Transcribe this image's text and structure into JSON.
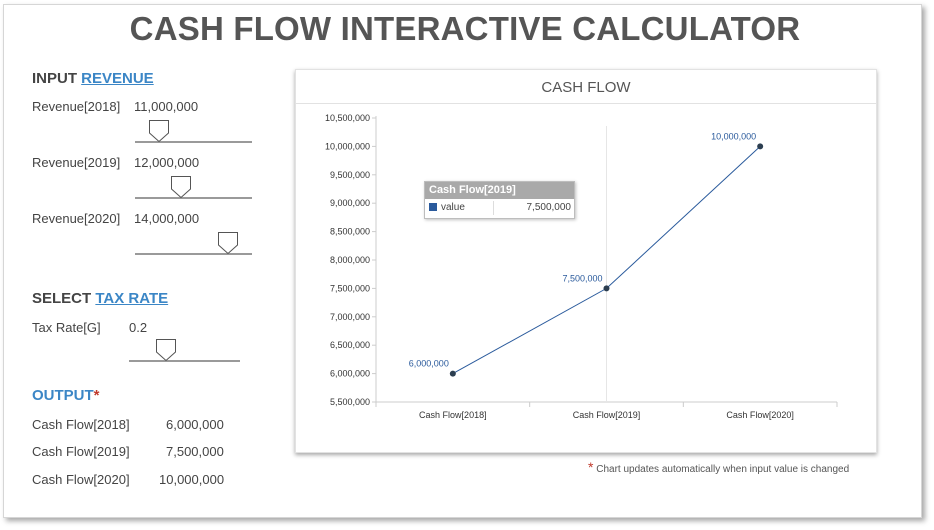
{
  "title": "CASH FLOW INTERACTIVE CALCULATOR",
  "input_section": {
    "prefix": "INPUT",
    "link": "REVENUE"
  },
  "revenue_inputs": [
    {
      "label": "Revenue[2018]",
      "value": "11,000,000"
    },
    {
      "label": "Revenue[2019]",
      "value": "12,000,000"
    },
    {
      "label": "Revenue[2020]",
      "value": "14,000,000"
    }
  ],
  "tax_section": {
    "prefix": "SELECT",
    "link": "TAX RATE"
  },
  "tax_input": {
    "label": "Tax Rate[G]",
    "value": "0.2"
  },
  "output_section": {
    "title": "OUTPUT",
    "marker": "*"
  },
  "outputs": [
    {
      "label": "Cash Flow[2018]",
      "value": "6,000,000"
    },
    {
      "label": "Cash Flow[2019]",
      "value": "7,500,000"
    },
    {
      "label": "Cash Flow[2020]",
      "value": "10,000,000"
    }
  ],
  "chart_data": {
    "type": "line",
    "title": "CASH FLOW",
    "categories": [
      "Cash Flow[2018]",
      "Cash Flow[2019]",
      "Cash Flow[2020]"
    ],
    "series": [
      {
        "values": [
          6000000,
          7500000,
          10000000
        ]
      }
    ],
    "data_labels": [
      "6,000,000",
      "7,500,000",
      "10,000,000"
    ],
    "y_ticks": [
      "10,500,000",
      "10,000,000",
      "9,500,000",
      "9,000,000",
      "8,500,000",
      "8,000,000",
      "7,500,000",
      "7,000,000",
      "6,500,000",
      "6,000,000",
      "5,500,000"
    ],
    "ylim": [
      5500000,
      10500000
    ],
    "grid": false,
    "color": "#2a5a9c"
  },
  "tooltip": {
    "title": "Cash Flow[2019]",
    "series": "value",
    "value": "7,500,000"
  },
  "footnote": {
    "marker": "*",
    "text": "Chart updates automatically when input value is changed"
  },
  "colors": {
    "accent": "#3b86c6",
    "line": "#2a5a9c",
    "star": "#c0392b"
  }
}
